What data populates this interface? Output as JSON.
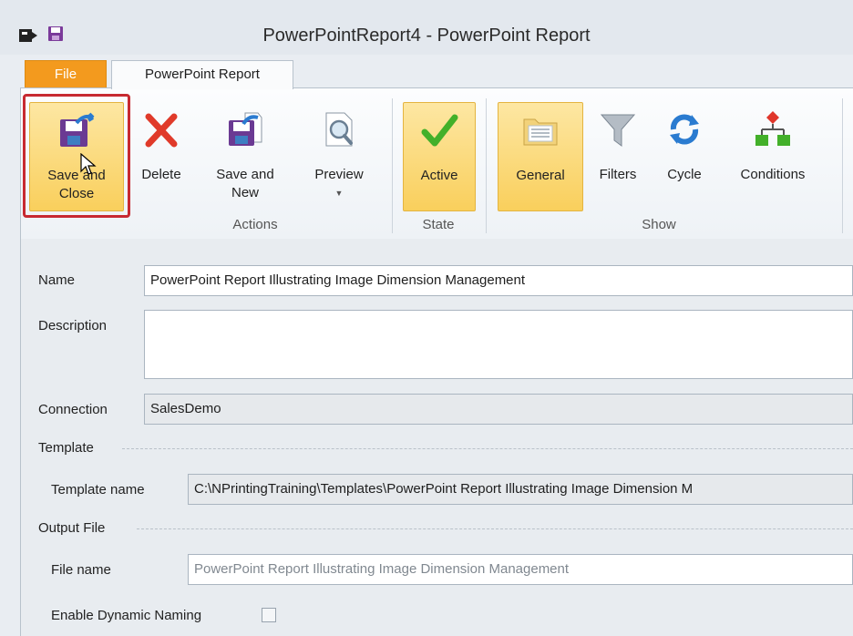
{
  "window": {
    "title": "PowerPointReport4 - PowerPoint Report"
  },
  "tabs": {
    "file": "File",
    "active": "PowerPoint Report"
  },
  "ribbon": {
    "groups": {
      "actions": "Actions",
      "state": "State",
      "show": "Show"
    },
    "buttons": {
      "save_close_1": "Save and",
      "save_close_2": "Close",
      "delete": "Delete",
      "save_new_1": "Save and",
      "save_new_2": "New",
      "preview": "Preview",
      "active": "Active",
      "general": "General",
      "filters": "Filters",
      "cycle": "Cycle",
      "conditions": "Conditions"
    }
  },
  "form": {
    "name_label": "Name",
    "name_value": "PowerPoint Report Illustrating Image Dimension Management",
    "description_label": "Description",
    "description_value": "",
    "connection_label": "Connection",
    "connection_value": "SalesDemo",
    "template_section": "Template",
    "template_name_label": "Template name",
    "template_name_value": "C:\\NPrintingTraining\\Templates\\PowerPoint Report Illustrating Image Dimension M",
    "output_section": "Output File",
    "file_name_label": "File name",
    "file_name_value": "PowerPoint Report Illustrating Image Dimension Management",
    "dynamic_naming_label": "Enable Dynamic Naming",
    "dynamic_naming_checked": false
  },
  "colors": {
    "file_tab": "#f39a1e",
    "highlight": "#f9cf5c",
    "outline": "#c72a31"
  }
}
